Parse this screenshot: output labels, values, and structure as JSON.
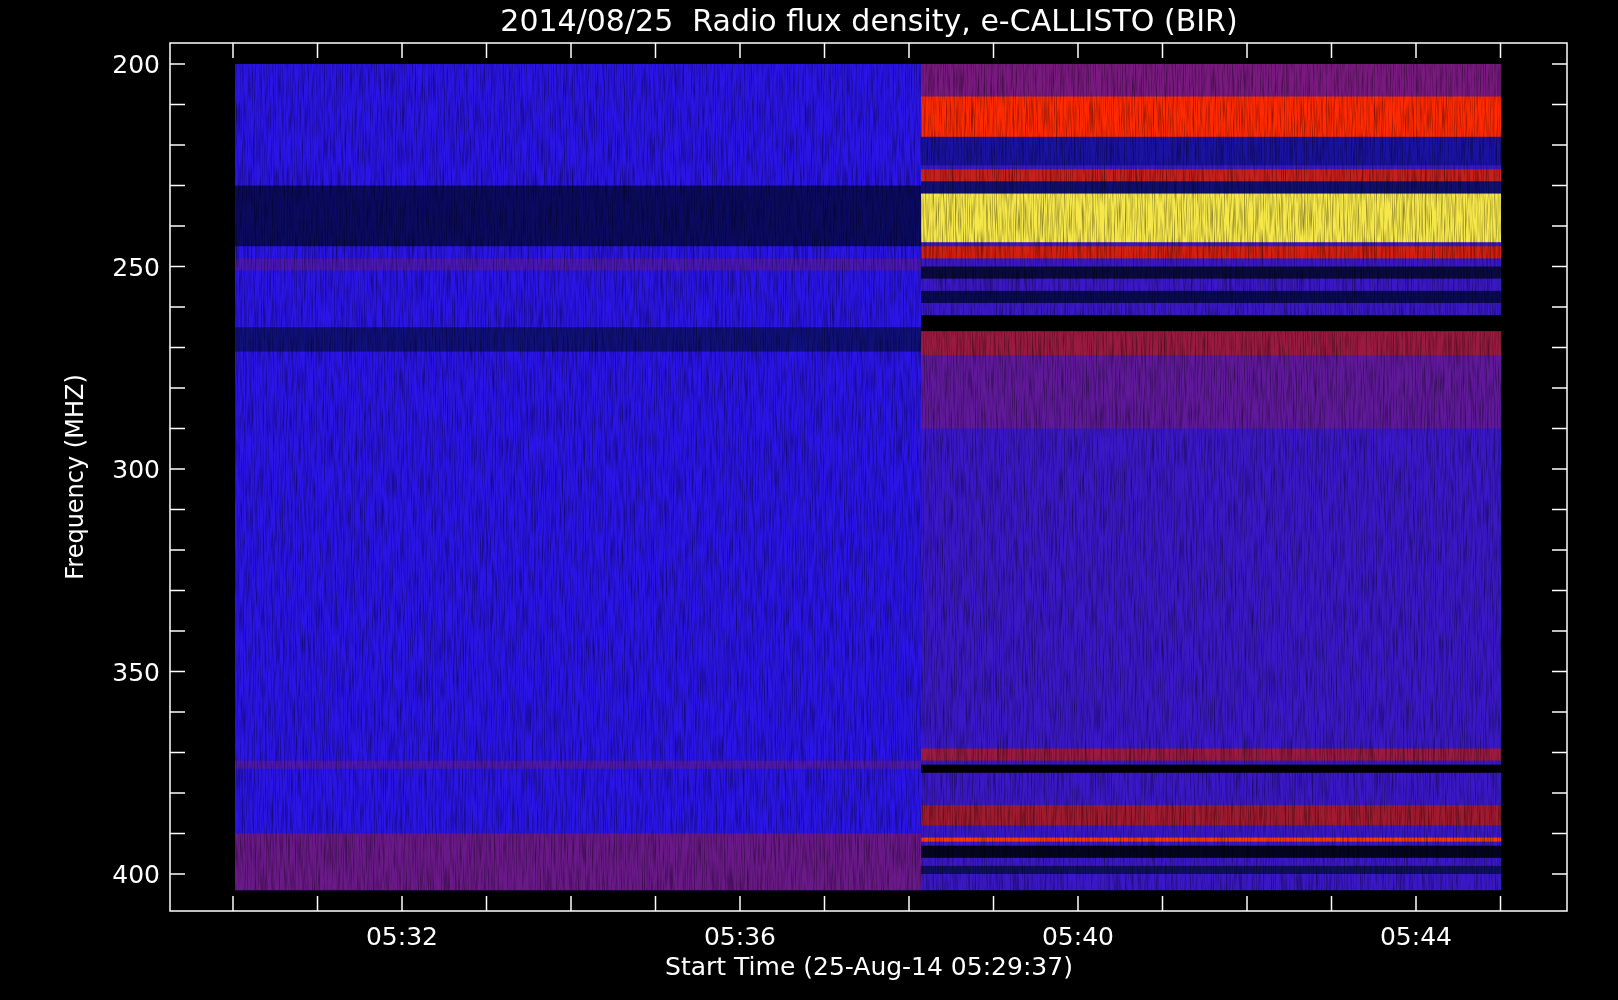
{
  "plot": {
    "title": "2014/08/25  Radio flux density, e-CALLISTO (BIR)",
    "ylabel": "Frequency (MHZ)",
    "xlabel": "Start Time (25-Aug-14 05:29:37)",
    "y_tick_labels": [
      "200",
      "250",
      "300",
      "350",
      "400"
    ],
    "x_tick_labels": [
      "05:32",
      "05:36",
      "05:40",
      "05:44"
    ]
  }
}
